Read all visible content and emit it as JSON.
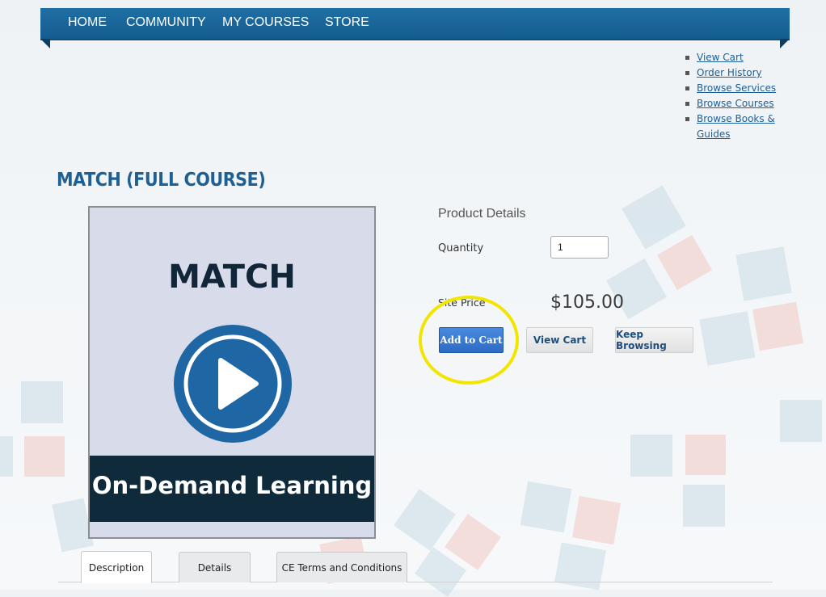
{
  "nav": {
    "items": [
      "HOME",
      "COMMUNITY",
      "MY COURSES",
      "STORE"
    ]
  },
  "links": [
    "View Cart",
    "Order History",
    "Browse Services",
    "Browse Courses",
    "Browse Books & Guides"
  ],
  "page_title": "MATCH (FULL COURSE)",
  "product_image": {
    "heading": "MATCH",
    "caption": "On-Demand Learning",
    "icon": "play-circle-icon"
  },
  "details": {
    "heading": "Product Details",
    "quantity_label": "Quantity",
    "quantity_value": "1",
    "price_label": "Site Price",
    "price": "$105.00"
  },
  "buttons": {
    "add_to_cart": "Add to Cart",
    "view_cart": "View Cart",
    "keep_browsing": "Keep Browsing"
  },
  "tabs": [
    "Description",
    "Details",
    "CE Terms and Conditions"
  ],
  "colors": {
    "nav": "#145c8e",
    "title": "#1e5f94",
    "link": "#1e5f99",
    "add_button": "#2d6cc4",
    "highlight": "#f2e600"
  }
}
